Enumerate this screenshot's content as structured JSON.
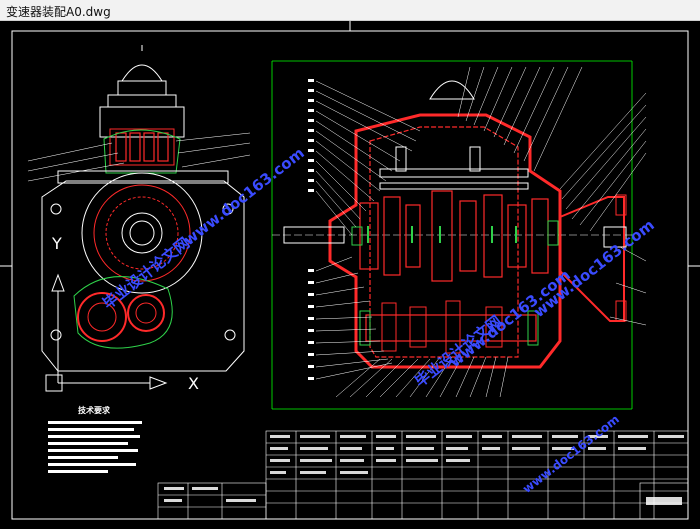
{
  "window": {
    "title": "变速器装配A0.dwg"
  },
  "drawing": {
    "axis_x_label": "X",
    "axis_y_label": "Y",
    "notes_heading": "技术要求"
  },
  "watermarks": {
    "site_url": "www.doc163.com",
    "site_name": "毕业设计论文网"
  },
  "colors": {
    "background": "#000000",
    "frame": "#ffffff",
    "hatch": "#ff2a2a",
    "gear_outline": "#2fd24a",
    "dimension": "#00ff00",
    "watermark": "#3a4bff"
  }
}
